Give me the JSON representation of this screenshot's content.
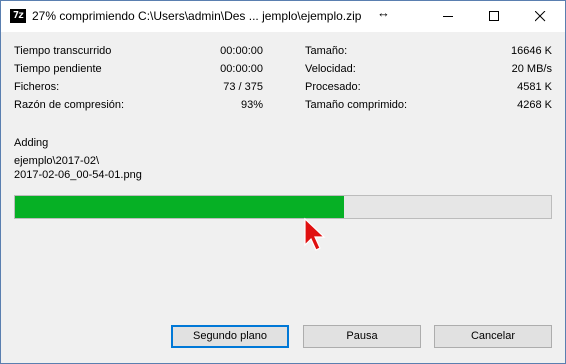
{
  "window": {
    "title": "27% comprimiendo C:\\Users\\admin\\Des ... jemplo\\ejemplo.zip",
    "app_icon_text": "7z"
  },
  "stats_left": [
    {
      "label": "Tiempo transcurrido",
      "value": "00:00:00"
    },
    {
      "label": "Tiempo pendiente",
      "value": "00:00:00"
    },
    {
      "label": "Ficheros:",
      "value": "73 / 375"
    },
    {
      "label": "Razón de compresión:",
      "value": "93%"
    }
  ],
  "stats_right": [
    {
      "label": "Tamaño:",
      "value": "16646 K"
    },
    {
      "label": "Velocidad:",
      "value": "20 MB/s"
    },
    {
      "label": "Procesado:",
      "value": "4581 K"
    },
    {
      "label": "Tamaño comprimido:",
      "value": "4268 K"
    }
  ],
  "activity": "Adding",
  "current_file": {
    "line1": "ejemplo\\2017-02\\",
    "line2": "2017-02-06_00-54-01.png"
  },
  "progress": {
    "fraction": 0.6145,
    "color": "#06b025"
  },
  "buttons": {
    "background": "Segundo plano",
    "pause": "Pausa",
    "cancel": "Cancelar"
  },
  "icons": {
    "resize": "resize-horizontal-icon",
    "cursor": "mouse-pointer-icon"
  }
}
